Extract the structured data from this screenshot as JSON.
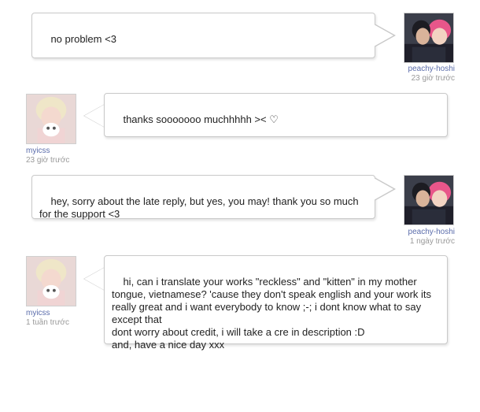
{
  "messages": [
    {
      "user": "peachy-hoshi",
      "time": "23 giờ trước",
      "text": "no problem <3",
      "avatar": "couple-photo-avatar"
    },
    {
      "user": "myicss",
      "time": "23 giờ trước",
      "text": "thanks sooooooo muchhhhh >< ♡",
      "avatar": "blonde-person-avatar"
    },
    {
      "user": "peachy-hoshi",
      "time": "1 ngày trước",
      "text": "hey, sorry about the late reply, but yes, you may! thank you so much for the support <3",
      "avatar": "couple-photo-avatar"
    },
    {
      "user": "myicss",
      "time": "1 tuần trước",
      "text": "hi, can i translate your works \"reckless\" and \"kitten\" in my mother tongue, vietnamese? 'cause they don't speak english and your work its really great and i want everybody to know ;-; i dont know what to say except that\ndont worry about credit, i will take a cre in description :D\nand, have a nice day xxx",
      "avatar": "blonde-person-avatar"
    }
  ],
  "colors": {
    "username": "#5b6dab",
    "timestamp": "#999999",
    "bubble_border": "#c9c9c9",
    "text": "#222222"
  }
}
